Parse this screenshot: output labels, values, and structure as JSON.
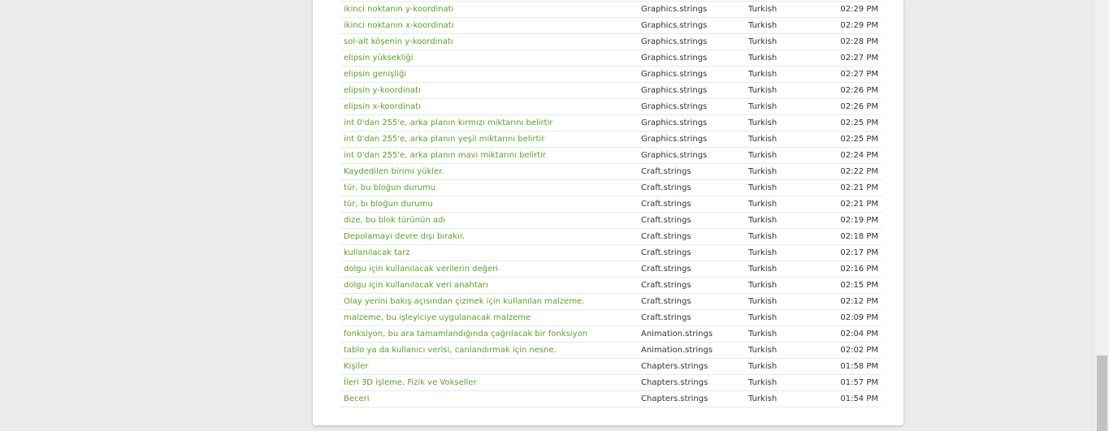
{
  "activity_rows": [
    {
      "string": "ikinci noktanın y-koordinatı",
      "file": "Graphics.strings",
      "language": "Turkish",
      "time": "02:29 PM"
    },
    {
      "string": "ikinci noktanın x-koordinatı",
      "file": "Graphics.strings",
      "language": "Turkish",
      "time": "02:29 PM"
    },
    {
      "string": "sol-alt köşenin y-koordinatı",
      "file": "Graphics.strings",
      "language": "Turkish",
      "time": "02:28 PM"
    },
    {
      "string": "elipsin yüksekliği",
      "file": "Graphics.strings",
      "language": "Turkish",
      "time": "02:27 PM"
    },
    {
      "string": "elipsin genişliği",
      "file": "Graphics.strings",
      "language": "Turkish",
      "time": "02:27 PM"
    },
    {
      "string": "elipsin y-koordinatı",
      "file": "Graphics.strings",
      "language": "Turkish",
      "time": "02:26 PM"
    },
    {
      "string": "elipsin x-koordinatı",
      "file": "Graphics.strings",
      "language": "Turkish",
      "time": "02:26 PM"
    },
    {
      "string": "int 0'dan 255'e, arka planın kırmızı miktarını belirtir",
      "file": "Graphics.strings",
      "language": "Turkish",
      "time": "02:25 PM"
    },
    {
      "string": "int 0'dan 255'e, arka planın yeşil miktarını belirtir",
      "file": "Graphics.strings",
      "language": "Turkish",
      "time": "02:25 PM"
    },
    {
      "string": "int 0'dan 255'e, arka planın mavi miktarını belirtir",
      "file": "Graphics.strings",
      "language": "Turkish",
      "time": "02:24 PM"
    },
    {
      "string": "Kaydedilen birimi yükler.",
      "file": "Craft.strings",
      "language": "Turkish",
      "time": "02:22 PM"
    },
    {
      "string": "tür, bu bloğun durumu",
      "file": "Craft.strings",
      "language": "Turkish",
      "time": "02:21 PM"
    },
    {
      "string": "tür, bı bloğun durumu",
      "file": "Craft.strings",
      "language": "Turkish",
      "time": "02:21 PM"
    },
    {
      "string": "dize, bu blok türünün adı",
      "file": "Craft.strings",
      "language": "Turkish",
      "time": "02:19 PM"
    },
    {
      "string": "Depolamayı devre dışı bırakır.",
      "file": "Craft.strings",
      "language": "Turkish",
      "time": "02:18 PM"
    },
    {
      "string": "kullanılacak tarz",
      "file": "Craft.strings",
      "language": "Turkish",
      "time": "02:17 PM"
    },
    {
      "string": "dolgu için kullanılacak verilerin değeri",
      "file": "Craft.strings",
      "language": "Turkish",
      "time": "02:16 PM"
    },
    {
      "string": "dolgu için kullanılacak veri anahtarı",
      "file": "Craft.strings",
      "language": "Turkish",
      "time": "02:15 PM"
    },
    {
      "string": "Olay yerini bakış açısından çizmek için kullanılan malzeme.",
      "file": "Craft.strings",
      "language": "Turkish",
      "time": "02:12 PM"
    },
    {
      "string": "malzeme, bu işleyiciye uygulanacak malzeme",
      "file": "Craft.strings",
      "language": "Turkish",
      "time": "02:09 PM"
    },
    {
      "string": "fonksiyon, bu ara tamamlandığında çağrılacak bir fonksiyon",
      "file": "Animation.strings",
      "language": "Turkish",
      "time": "02:04 PM"
    },
    {
      "string": "tablo ya da kullanıcı verisi, canlandırmak için nesne.",
      "file": "Animation.strings",
      "language": "Turkish",
      "time": "02:02 PM"
    },
    {
      "string": "Kişiler",
      "file": "Chapters.strings",
      "language": "Turkish",
      "time": "01:58 PM"
    },
    {
      "string": "İleri 3D işleme, Fizik ve Vokseller",
      "file": "Chapters.strings",
      "language": "Turkish",
      "time": "01:57 PM"
    },
    {
      "string": "Beceri",
      "file": "Chapters.strings",
      "language": "Turkish",
      "time": "01:54 PM"
    }
  ],
  "colors": {
    "link": "#5b9f2a",
    "text": "#333333",
    "background": "#ebebeb",
    "card": "#ffffff"
  }
}
